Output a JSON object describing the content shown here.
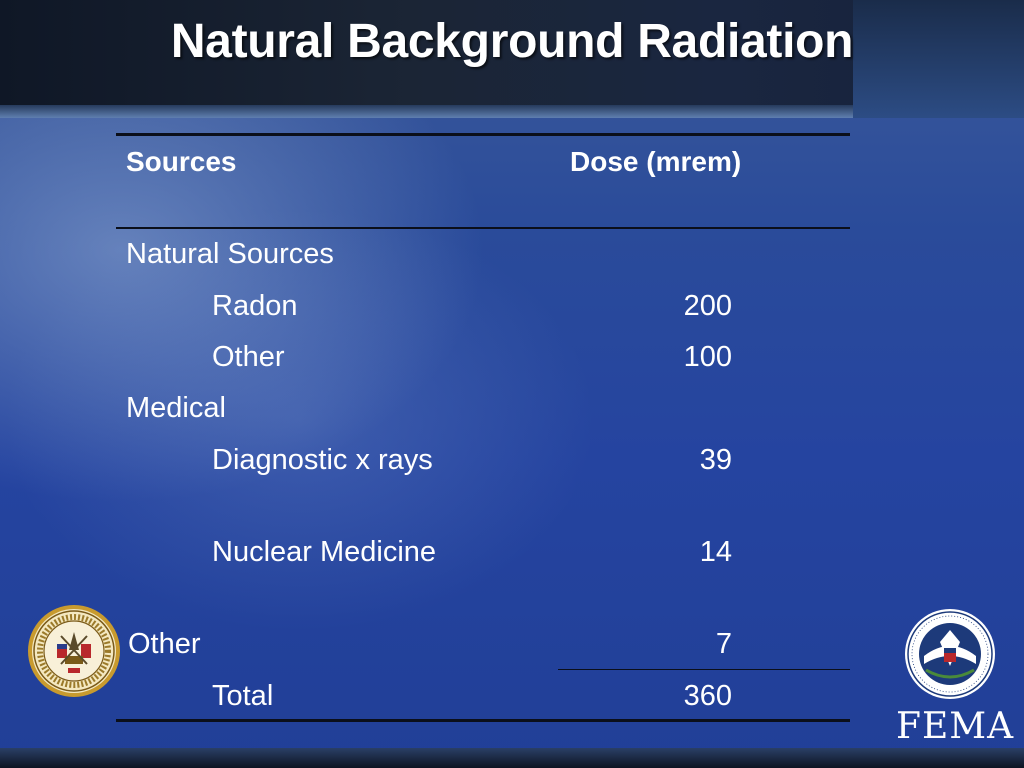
{
  "slide": {
    "title": "Natural Background Radiation"
  },
  "table": {
    "headers": {
      "sources": "Sources",
      "dose": "Dose (mrem)"
    },
    "rows": [
      {
        "label": "Natural Sources",
        "value": ""
      },
      {
        "label": "Radon",
        "value": "200"
      },
      {
        "label": "Other",
        "value": "100"
      },
      {
        "label": "Medical",
        "value": ""
      },
      {
        "label": "Diagnostic x rays",
        "value": "39"
      },
      {
        "label": "Nuclear Medicine",
        "value": "14"
      },
      {
        "label": "Other",
        "value": "7"
      },
      {
        "label": "Total",
        "value": "360"
      }
    ]
  },
  "logos": {
    "left": {
      "icon": "army-seal-icon"
    },
    "right": {
      "icon": "dhs-seal-icon",
      "text": "FEMA"
    }
  },
  "colors": {
    "background": "#2544a0",
    "title_bar": "#1b2535",
    "text": "#ffffff"
  }
}
